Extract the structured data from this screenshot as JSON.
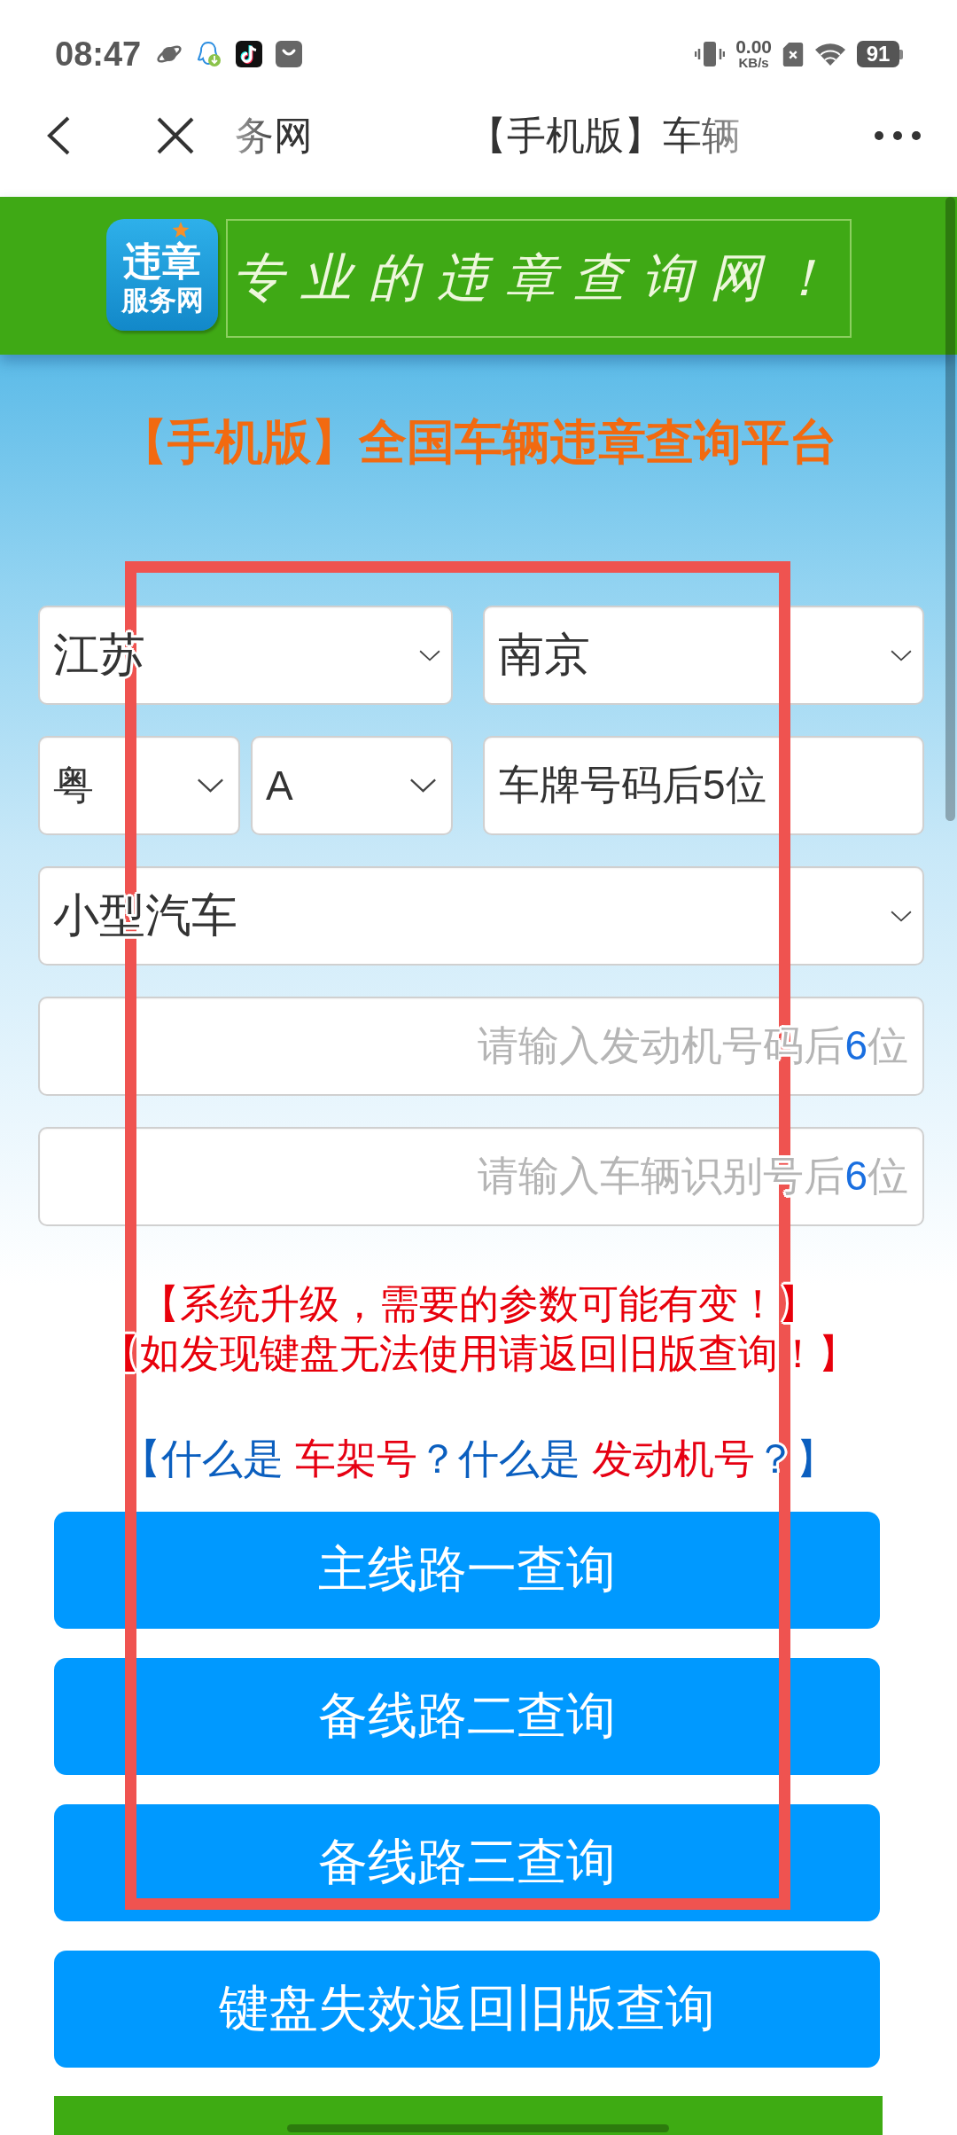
{
  "status_bar": {
    "time": "08:47",
    "net_speed": {
      "value": "0.00",
      "unit": "KB/s"
    },
    "battery": "91"
  },
  "nav_bar": {
    "site_name": "务网",
    "title": "【手机版】车辆"
  },
  "header": {
    "logo_lines": [
      "违章",
      "服务网"
    ],
    "slogan": "专业的违章查询网！"
  },
  "heading": "【手机版】全国车辆违章查询平台",
  "form": {
    "rows": [
      [
        {
          "kind": "select",
          "value": "江苏"
        },
        {
          "kind": "select",
          "value": "南京"
        }
      ],
      [
        {
          "kind": "pair",
          "fields": [
            {
              "kind": "select",
              "value": "粤"
            },
            {
              "kind": "select",
              "value": "A"
            }
          ]
        },
        {
          "kind": "input",
          "value": "车牌号码后5位"
        }
      ],
      [
        {
          "kind": "select",
          "value": "小型汽车"
        }
      ],
      [
        {
          "kind": "input",
          "placeholder": [
            {
              "text": "请输入发动机号码后",
              "highlight": false
            },
            {
              "text": "6",
              "highlight": true
            },
            {
              "text": "位",
              "highlight": false
            }
          ]
        }
      ],
      [
        {
          "kind": "input",
          "placeholder": [
            {
              "text": "请输入车辆识别号后",
              "highlight": false
            },
            {
              "text": "6",
              "highlight": true
            },
            {
              "text": "位",
              "highlight": false
            }
          ]
        }
      ]
    ]
  },
  "notices": [
    "【系统升级，需要的参数可能有变！】",
    "【如发现键盘无法使用请返回旧版查询！】"
  ],
  "help_line": [
    {
      "kind": "text",
      "text": "【什么是 "
    },
    {
      "kind": "link",
      "text": "车架号"
    },
    {
      "kind": "text",
      "text": "？什么是 "
    },
    {
      "kind": "link",
      "text": "发动机号"
    },
    {
      "kind": "text",
      "text": "？】"
    }
  ],
  "buttons": [
    "主线路一查询",
    "备线路二查询",
    "备线路三查询",
    "键盘失效返回旧版查询"
  ]
}
